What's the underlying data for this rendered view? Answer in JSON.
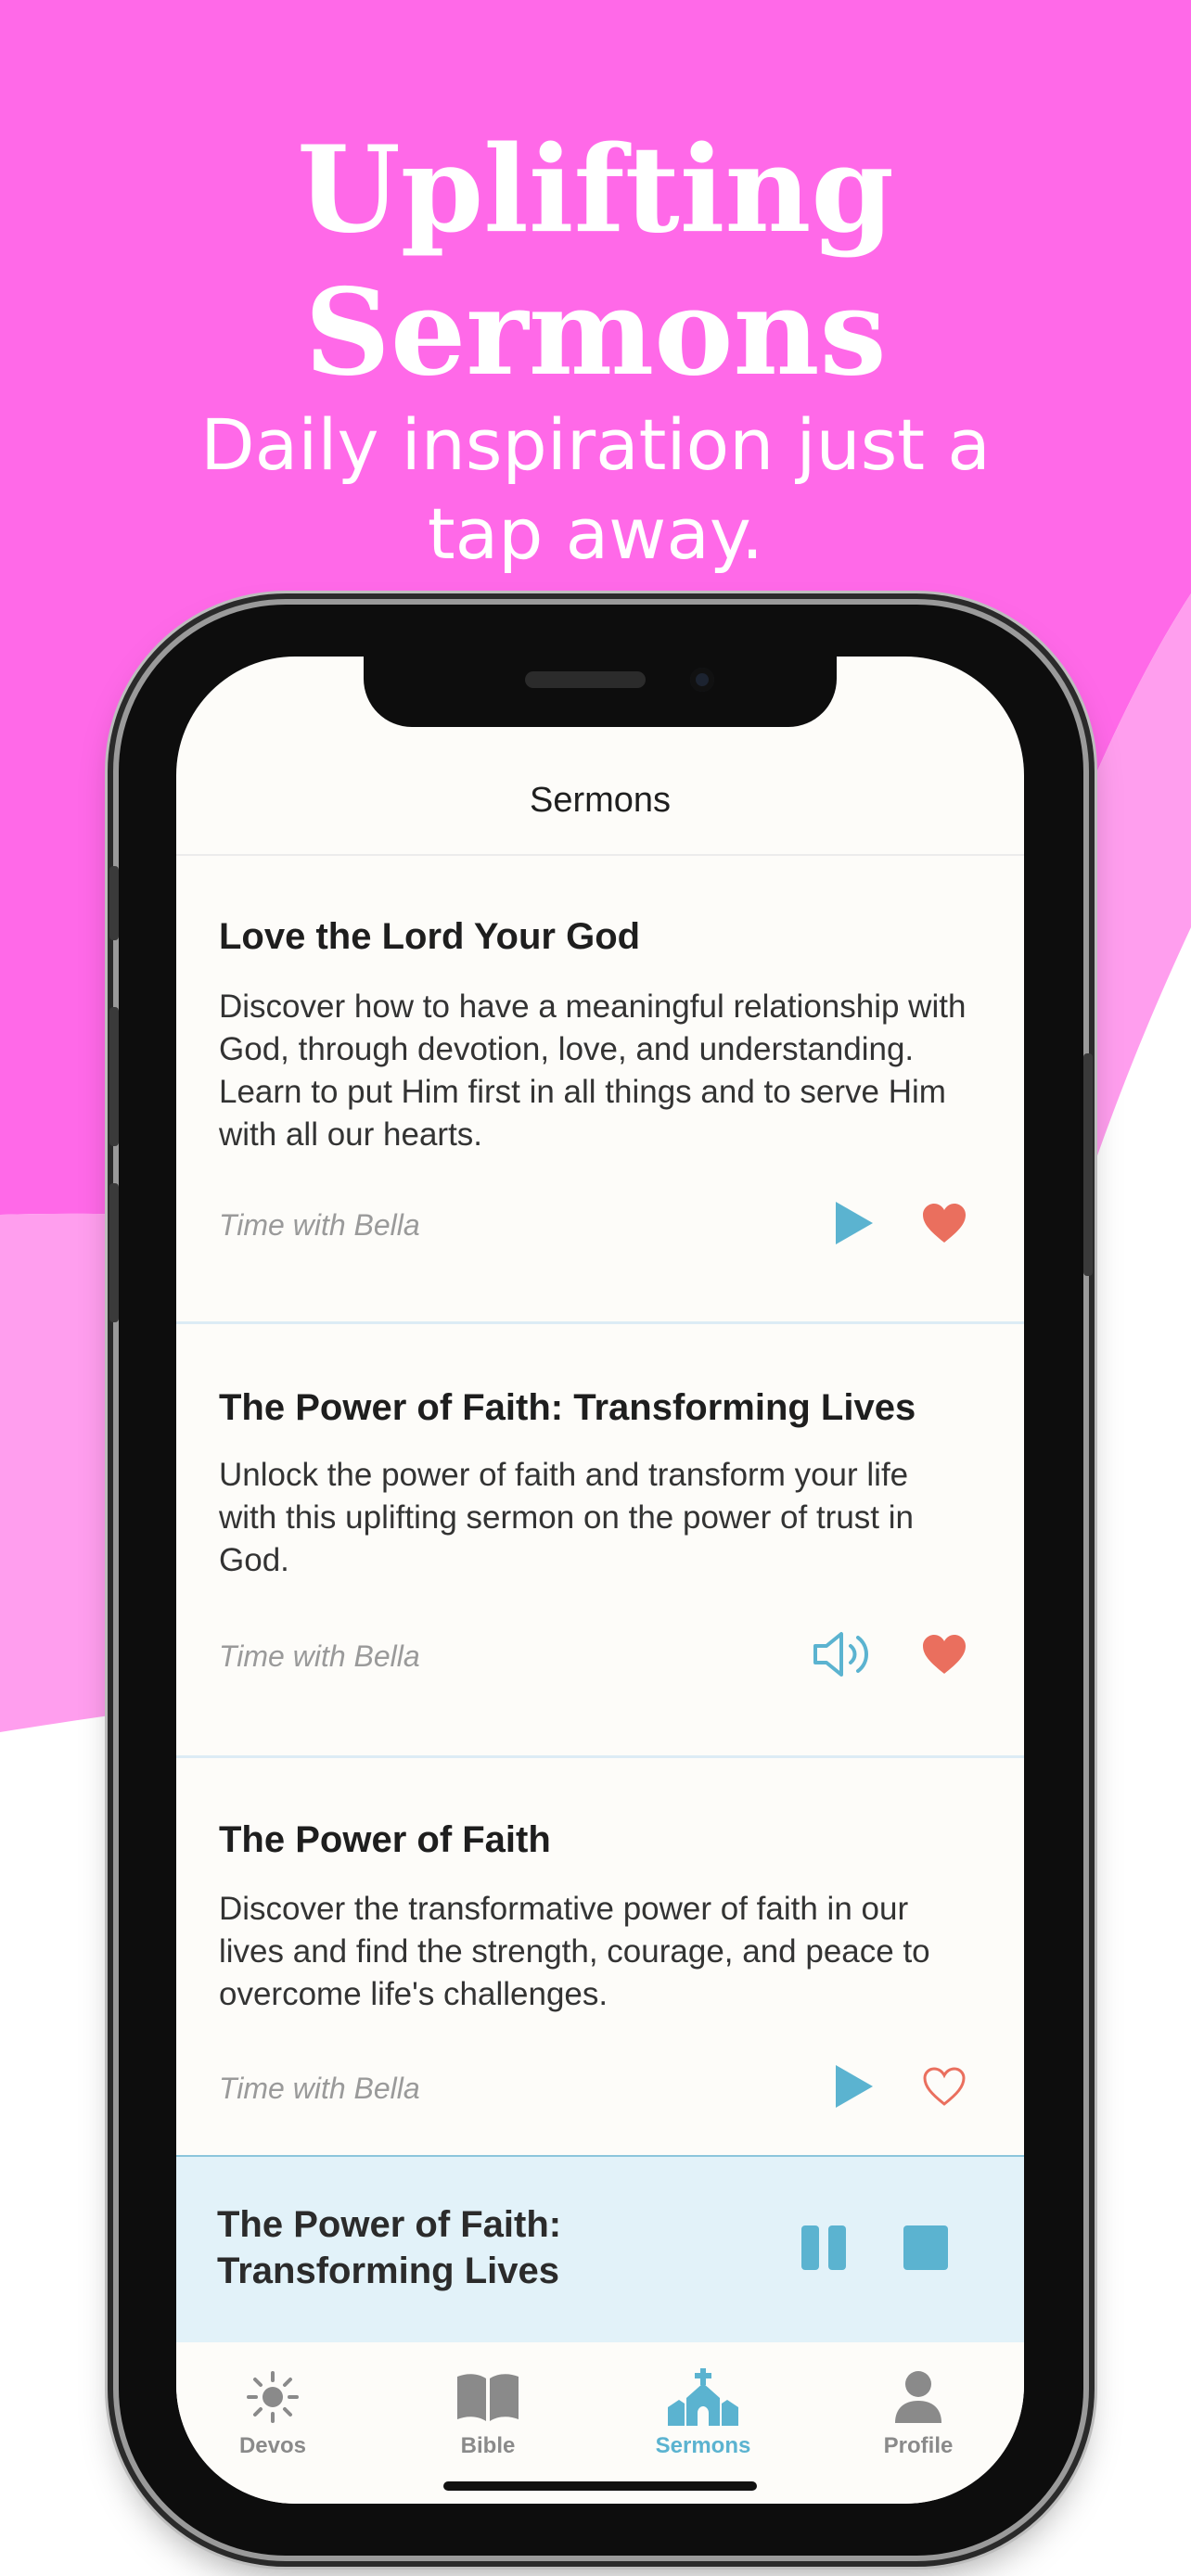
{
  "hero": {
    "title_line1": "Uplifting",
    "title_line2": "Sermons",
    "subtitle": "Daily inspiration just a tap away."
  },
  "colors": {
    "background_pink": "#ff69e8",
    "light_pink": "#ff9eee",
    "accent_blue": "#5bb3d0",
    "heart_red": "#ea6f5e",
    "player_bg": "#e2f2f9"
  },
  "screen": {
    "nav_title": "Sermons",
    "sermons": [
      {
        "title": "Love the Lord Your God",
        "description": "Discover how to have a meaningful relationship with God, through devotion, love, and understanding. Learn to put Him first in all things and to serve Him with all our hearts.",
        "author": "Time with Bella",
        "action_icon": "play-icon",
        "favorited": true
      },
      {
        "title": "The Power of Faith: Transforming Lives",
        "description": "Unlock the power of faith and transform your life with this uplifting sermon on the power of trust in God.",
        "author": "Time with Bella",
        "action_icon": "speaker-icon",
        "favorited": true
      },
      {
        "title": "The Power of Faith",
        "description": "Discover the transformative power of faith in our lives and find the strength, courage, and peace to overcome life's challenges.",
        "author": "Time with Bella",
        "action_icon": "play-icon",
        "favorited": false
      }
    ],
    "now_playing": {
      "title": "The Power of Faith: Transforming Lives"
    },
    "tabs": [
      {
        "label": "Devos",
        "icon": "sun-icon",
        "active": false
      },
      {
        "label": "Bible",
        "icon": "book-icon",
        "active": false
      },
      {
        "label": "Sermons",
        "icon": "church-icon",
        "active": true
      },
      {
        "label": "Profile",
        "icon": "person-icon",
        "active": false
      }
    ]
  }
}
